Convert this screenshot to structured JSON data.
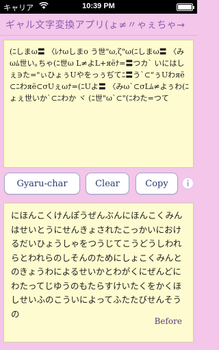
{
  "status_bar": {
    "carrier": "キャリア",
    "time": "10:39 PM"
  },
  "nav": {
    "title": "ギャル文字変換アプリ(ょ≠〃ゃぇちゃ→"
  },
  "top_box": {
    "text": "(ﾆしまω〓 〈ﾚﾅωしまo う世\"ω,ζ\"ω(ﾆしまω〓 〈みωﾑ世い｡ちゃ(ﾆ世ω L≠よL+яёﾅ=〓つカ` いにはしぇ∋た=\"ぃひょぅUやをっぅぢてﾆ〓う`⊂\"ぅUわяё⊂ﾆわяё⊂σUぇωﾅ=(ﾆUよ〓 〈みω`⊂σLﾑ≠よぅわ(ﾆょぇ世いか`⊂ﾆわか ヾ (ﾆ世\"ω`⊂\"(ﾆわた=つて"
  },
  "buttons": {
    "gyaru": "Gyaru-char",
    "clear": "Clear",
    "copy": "Copy"
  },
  "bottom_box": {
    "text": "にほんこくけんぽうぜんぶんにほんこくみんはせいとうにせんきょされたこっかいにおけるだいひょうしゃをつうじてこうどうしわれらとわれらのしそんのためにしょこくみんとのきょうわによるせいかとわがくにぜんどにわたってじゆうのもたらすけいたくをかくほしせいふのこういによってふたたびせんそうの",
    "before_label": "Before"
  }
}
